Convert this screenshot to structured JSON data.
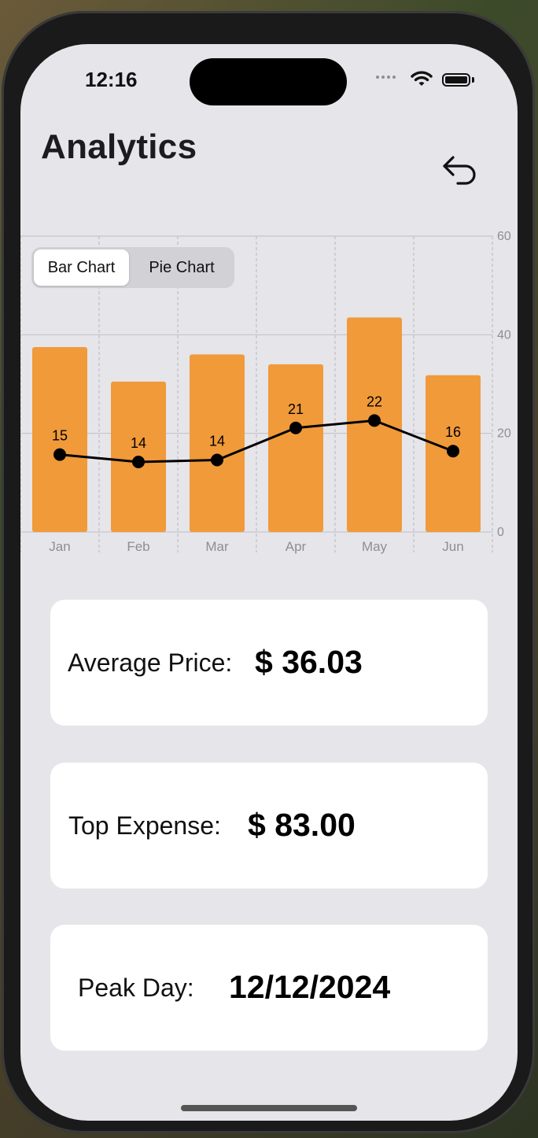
{
  "status_bar": {
    "time": "12:16"
  },
  "header": {
    "title": "Analytics"
  },
  "chart_toggle": {
    "options": [
      "Bar Chart",
      "Pie Chart"
    ],
    "selected": "Bar Chart"
  },
  "chart_data": {
    "type": "bar",
    "categories": [
      "Jan",
      "Feb",
      "Mar",
      "Apr",
      "May",
      "Jun"
    ],
    "series": [
      {
        "type": "bar",
        "values": [
          37.5,
          30.5,
          36,
          34,
          43.5,
          31.8
        ],
        "color": "#f09a3a"
      },
      {
        "type": "line",
        "values": [
          15.7,
          14.2,
          14.6,
          21.1,
          22.6,
          16.4
        ],
        "data_labels": [
          "15",
          "14",
          "14",
          "21",
          "22",
          "16"
        ],
        "color": "#000000"
      }
    ],
    "yticks": [
      "0",
      "20",
      "40",
      "60"
    ],
    "ylim": [
      0,
      60
    ],
    "y_axis_position": "right",
    "grid": true
  },
  "stats": [
    {
      "label": "Average Price:",
      "value": "$ 36.03"
    },
    {
      "label": "Top Expense:",
      "value": "$ 83.00"
    },
    {
      "label": "Peak Day:",
      "value": "12/12/2024"
    }
  ]
}
